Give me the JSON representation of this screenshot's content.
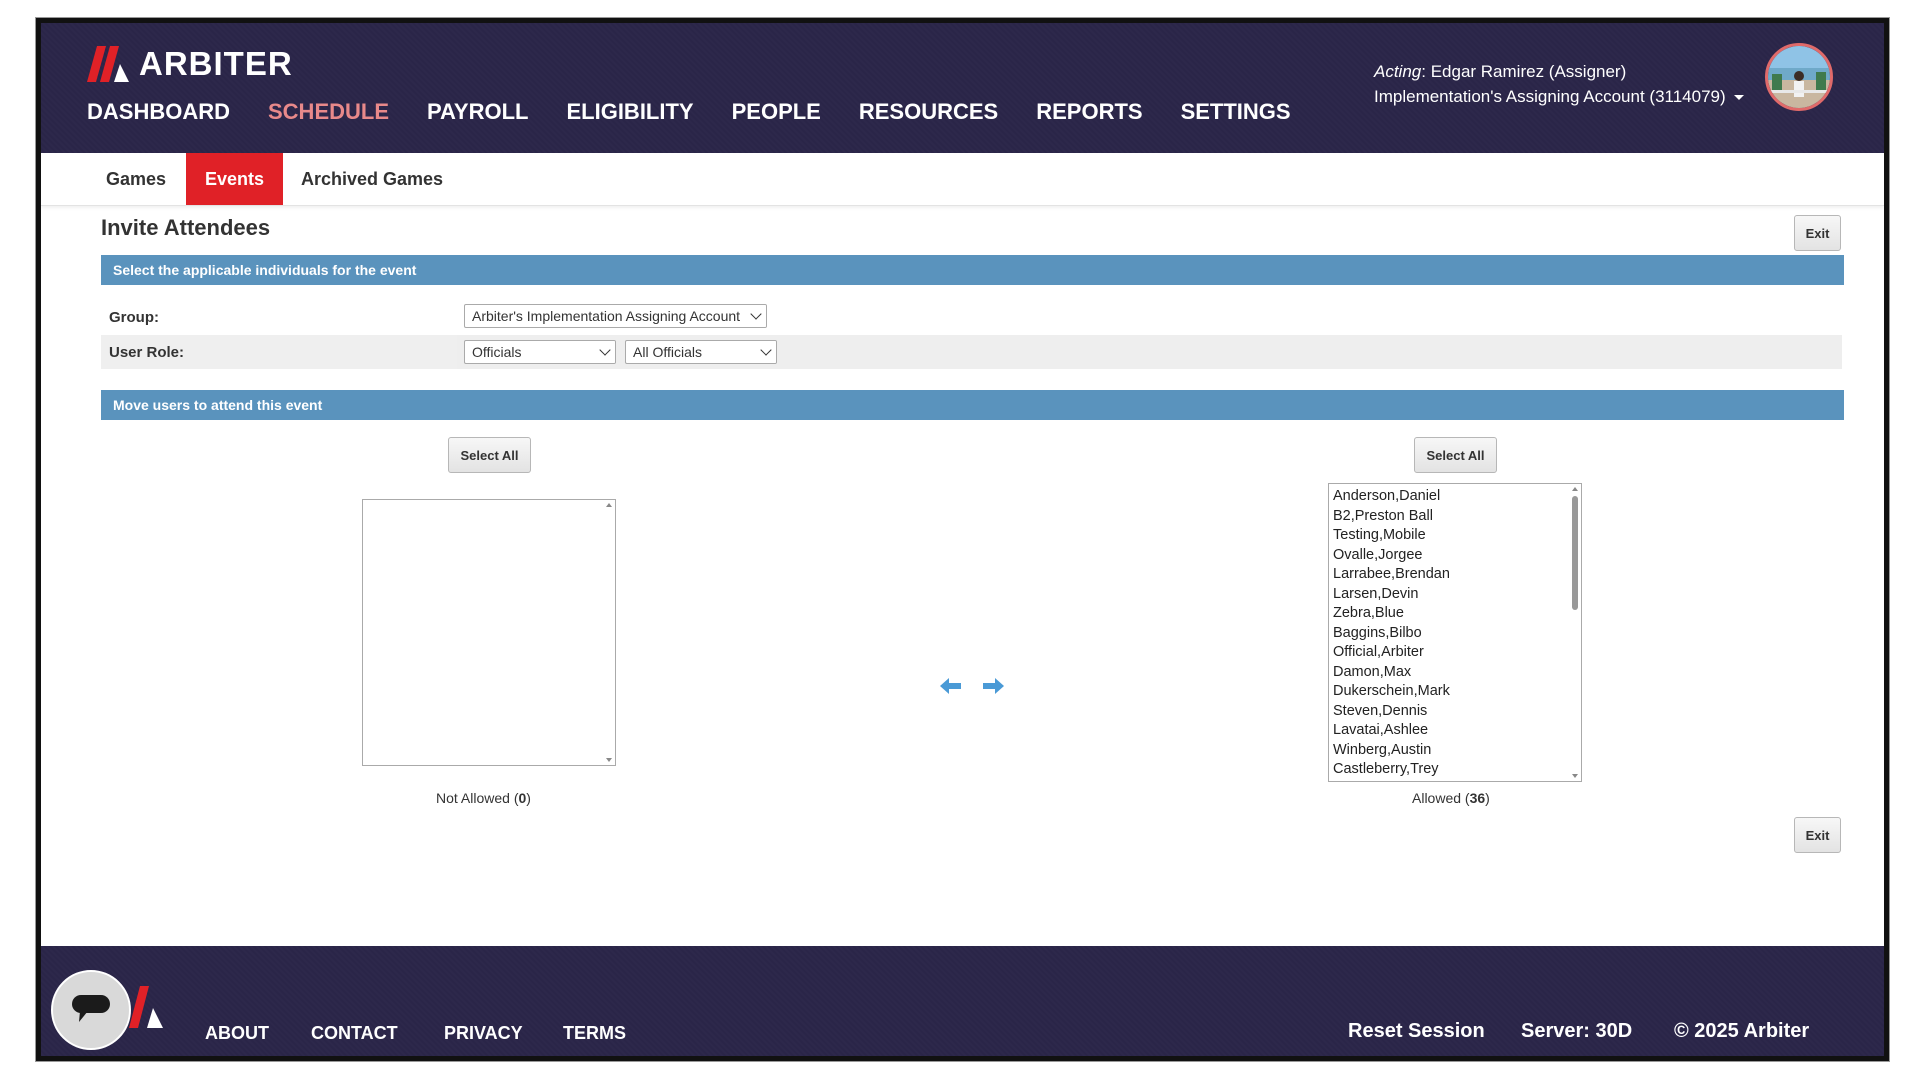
{
  "brand": {
    "name": "ARBITER"
  },
  "nav": {
    "items": [
      {
        "label": "DASHBOARD",
        "active": false
      },
      {
        "label": "SCHEDULE",
        "active": true
      },
      {
        "label": "PAYROLL",
        "active": false
      },
      {
        "label": "ELIGIBILITY",
        "active": false
      },
      {
        "label": "PEOPLE",
        "active": false
      },
      {
        "label": "RESOURCES",
        "active": false
      },
      {
        "label": "REPORTS",
        "active": false
      },
      {
        "label": "SETTINGS",
        "active": false
      }
    ]
  },
  "account": {
    "acting_prefix": "Acting",
    "acting_name": ": Edgar Ramirez (Assigner)",
    "account_name": "Implementation's Assigning Account (3114079)"
  },
  "subtabs": [
    {
      "label": "Games",
      "active": false
    },
    {
      "label": "Events",
      "active": true
    },
    {
      "label": "Archived Games",
      "active": false
    }
  ],
  "page": {
    "title": "Invite Attendees",
    "exit_label": "Exit",
    "section1": "Select the applicable individuals for the event",
    "section2": "Move users to attend this event",
    "group_label": "Group:",
    "group_value": "Arbiter's Implementation Assigning Account",
    "role_label": "User Role:",
    "role_value": "Officials",
    "role_filter_value": "All Officials",
    "select_all_label": "Select All"
  },
  "not_allowed": {
    "label": "Not Allowed",
    "count": "0",
    "items": []
  },
  "allowed": {
    "label": "Allowed",
    "count": "36",
    "items": [
      "Anderson,Daniel",
      "B2,Preston Ball",
      "Testing,Mobile",
      "Ovalle,Jorgee",
      "Larrabee,Brendan",
      "Larsen,Devin",
      "Zebra,Blue",
      "Baggins,Bilbo",
      "Official,Arbiter",
      "Damon,Max",
      "Dukerschein,Mark",
      "Steven,Dennis",
      "Lavatai,Ashlee",
      "Winberg,Austin",
      "Castleberry,Trey"
    ]
  },
  "footer": {
    "links": [
      "ABOUT",
      "CONTACT",
      "PRIVACY",
      "TERMS"
    ],
    "reset_session": "Reset Session",
    "server": "Server: 30D",
    "copyright": "© 2025 Arbiter"
  },
  "colors": {
    "header_bg": "#2a2548",
    "accent_red": "#e02127",
    "nav_active": "#e8898a",
    "section_bar": "#5a93bd",
    "arrow_blue": "#4a9ad6"
  },
  "icons": {
    "move_left": "arrow-left-icon",
    "move_right": "arrow-right-icon",
    "chat": "chat-bubble-icon",
    "account_menu": "caret-down-icon"
  }
}
